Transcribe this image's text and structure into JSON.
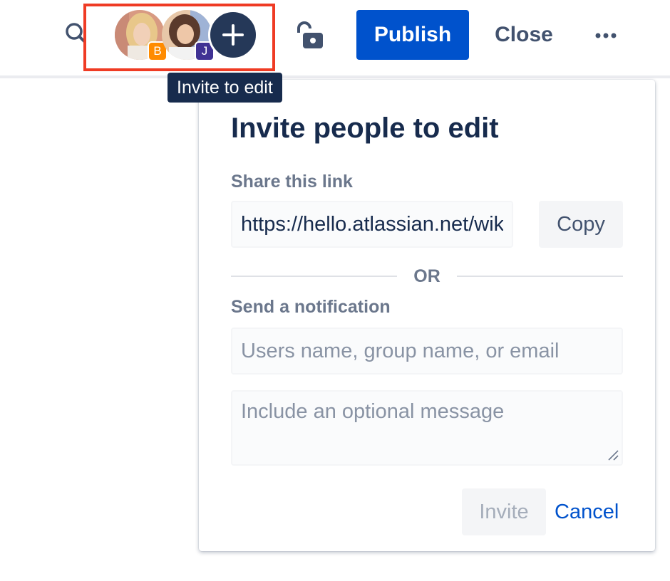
{
  "toolbar": {
    "publish_label": "Publish",
    "close_label": "Close",
    "icons": {
      "search": "search-icon",
      "lock": "unlock-icon",
      "more": "more-horizontal-icon",
      "add": "plus-icon"
    }
  },
  "collaborators": [
    {
      "initial": "B",
      "badge_color": "#ff8b00"
    },
    {
      "initial": "J",
      "badge_color": "#403294"
    }
  ],
  "tooltip": {
    "text": "Invite to edit"
  },
  "dialog": {
    "title": "Invite people to edit",
    "share_label": "Share this link",
    "link_value": "https://hello.atlassian.net/wiki/",
    "copy_label": "Copy",
    "or_text": "OR",
    "notify_label": "Send a notification",
    "users_placeholder": "Users name, group name, or email",
    "message_placeholder": "Include an optional message",
    "invite_label": "Invite",
    "cancel_label": "Cancel"
  },
  "colors": {
    "primary": "#0052cc",
    "highlight_border": "#ef3b24",
    "add_button": "#253858",
    "tooltip_bg": "#172b4d"
  }
}
